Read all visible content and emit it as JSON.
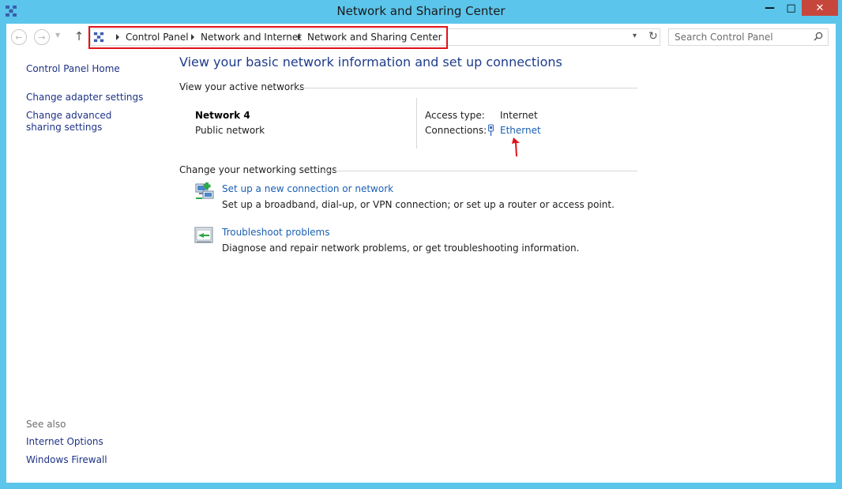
{
  "window": {
    "title": "Network and Sharing Center",
    "minimize_glyph": "—",
    "maximize_glyph": "□",
    "close_glyph": "✕"
  },
  "navigation": {
    "breadcrumbs": [
      "Control Panel",
      "Network and Internet",
      "Network and Sharing Center"
    ],
    "search_placeholder": "Search Control Panel"
  },
  "sidebar": {
    "home_link": "Control Panel Home",
    "links": [
      "Change adapter settings",
      "Change advanced sharing settings"
    ],
    "see_also_label": "See also",
    "see_also_links": [
      "Internet Options",
      "Windows Firewall"
    ]
  },
  "main": {
    "heading": "View your basic network information and set up connections",
    "active_networks_label": "View your active networks",
    "network": {
      "name": "Network  4",
      "type": "Public network",
      "access_type_label": "Access type:",
      "access_type_value": "Internet",
      "connections_label": "Connections:",
      "connection_link": "Ethernet"
    },
    "change_settings_label": "Change your networking settings",
    "tasks": [
      {
        "icon": "network-setup-icon",
        "link": "Set up a new connection or network",
        "description": "Set up a broadband, dial-up, or VPN connection; or set up a router or access point."
      },
      {
        "icon": "troubleshoot-icon",
        "link": "Troubleshoot problems",
        "description": "Diagnose and repair network problems, or get troubleshooting information."
      }
    ]
  },
  "colors": {
    "titlebar": "#5cc5eb",
    "close_button": "#c7463b",
    "link": "#1a5fb4",
    "heading": "#1e3c8c",
    "annotation_red": "#e0121a"
  }
}
